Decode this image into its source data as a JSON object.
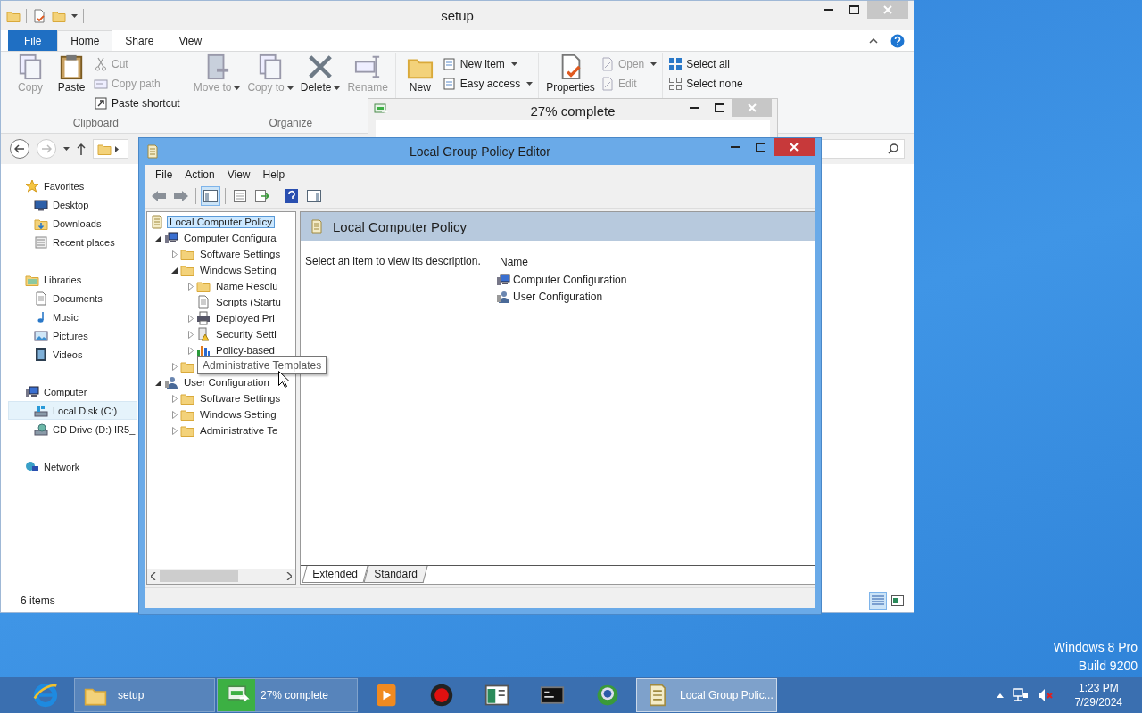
{
  "explorer": {
    "title": "setup",
    "ribbon_tabs": [
      {
        "label": "File",
        "kind": "file",
        "selected": false
      },
      {
        "label": "Home",
        "kind": "tab",
        "selected": true
      },
      {
        "label": "Share",
        "kind": "tab",
        "selected": false
      },
      {
        "label": "View",
        "kind": "tab",
        "selected": false
      }
    ],
    "ribbon_groups": [
      {
        "label": "Clipboard",
        "large": [
          {
            "label": "Copy",
            "kind": "copy",
            "disabled": true,
            "dropdown": false
          },
          {
            "label": "Paste",
            "kind": "paste",
            "disabled": false,
            "dropdown": false
          }
        ],
        "small": [
          {
            "label": "Cut",
            "kind": "cut",
            "disabled": true,
            "dropdown": false
          },
          {
            "label": "Copy path",
            "kind": "path",
            "disabled": true,
            "dropdown": false
          },
          {
            "label": "Paste shortcut",
            "kind": "shortcut",
            "disabled": false,
            "dropdown": false
          }
        ]
      },
      {
        "label": "Organize",
        "large": [
          {
            "label": "Move to",
            "kind": "move",
            "disabled": true,
            "dropdown": true
          },
          {
            "label": "Copy to",
            "kind": "copyto",
            "disabled": true,
            "dropdown": true
          },
          {
            "label": "Delete",
            "kind": "delete",
            "disabled": false,
            "dropdown": true
          },
          {
            "label": "Rename",
            "kind": "rename",
            "disabled": true,
            "dropdown": false
          }
        ]
      },
      {
        "large": [
          {
            "label": "New",
            "kind": "folder",
            "disabled": false,
            "dropdown": false
          }
        ],
        "small": [
          {
            "label": "New item",
            "kind": "newitem",
            "disabled": false,
            "dropdown": true
          },
          {
            "label": "Easy access",
            "kind": "easy",
            "disabled": false,
            "dropdown": true
          }
        ]
      },
      {
        "large": [
          {
            "label": "Properties",
            "kind": "properties",
            "disabled": false,
            "dropdown": false
          }
        ],
        "small": [
          {
            "label": "Open",
            "kind": "open",
            "disabled": true,
            "dropdown": true
          },
          {
            "label": "Edit",
            "kind": "edit",
            "disabled": true,
            "dropdown": false
          }
        ]
      },
      {
        "small": [
          {
            "label": "Select all",
            "kind": "selectall",
            "disabled": false,
            "dropdown": false
          },
          {
            "label": "Select none",
            "kind": "selectnone",
            "disabled": false,
            "dropdown": false
          }
        ]
      }
    ],
    "nav": [
      {
        "label": "Favorites",
        "kind": "star",
        "selected": false,
        "items": [
          {
            "label": "Desktop",
            "kind": "desktop",
            "selected": false
          },
          {
            "label": "Downloads",
            "kind": "downloads",
            "selected": false
          },
          {
            "label": "Recent places",
            "kind": "recent",
            "selected": false
          }
        ]
      },
      {
        "label": "Libraries",
        "kind": "libraries",
        "selected": false,
        "items": [
          {
            "label": "Documents",
            "kind": "document",
            "selected": false
          },
          {
            "label": "Music",
            "kind": "music",
            "selected": false
          },
          {
            "label": "Pictures",
            "kind": "pictures",
            "selected": false
          },
          {
            "label": "Videos",
            "kind": "videos",
            "selected": false
          }
        ]
      },
      {
        "label": "Computer",
        "kind": "computer",
        "selected": false,
        "items": [
          {
            "label": "Local Disk (C:)",
            "kind": "disk",
            "selected": true
          },
          {
            "label": "CD Drive (D:) IR5_",
            "kind": "cd",
            "selected": false
          }
        ]
      },
      {
        "label": "Network",
        "kind": "network",
        "selected": false
      }
    ],
    "status": "6 items"
  },
  "progress_dialog": {
    "title": "27% complete"
  },
  "gpe": {
    "title": "Local Group Policy Editor",
    "menu": [
      "File",
      "Action",
      "View",
      "Help"
    ],
    "tree": {
      "label": "Local Computer Policy",
      "kind": "policy",
      "selected": true,
      "children": [
        {
          "label": "Computer Configura",
          "kind": "computer",
          "expanded": true,
          "selected": false,
          "children": [
            {
              "label": "Software Settings",
              "kind": "folder",
              "expanded": false,
              "selected": false
            },
            {
              "label": "Windows Setting",
              "kind": "folder",
              "expanded": true,
              "selected": false,
              "children": [
                {
                  "label": "Name Resolu",
                  "kind": "folder",
                  "expanded": false,
                  "selected": false
                },
                {
                  "label": "Scripts (Startu",
                  "kind": "script",
                  "selected": false
                },
                {
                  "label": "Deployed Pri",
                  "kind": "printer",
                  "expanded": false,
                  "selected": false
                },
                {
                  "label": "Security Setti",
                  "kind": "security",
                  "expanded": false,
                  "selected": false
                },
                {
                  "label": "Policy-based",
                  "kind": "chart",
                  "expanded": false,
                  "selected": false
                }
              ]
            },
            {
              "kind": "folder",
              "expanded": false
            }
          ]
        },
        {
          "label": "User Configuration",
          "kind": "user",
          "expanded": true,
          "selected": false,
          "children": [
            {
              "label": "Software Settings",
              "kind": "folder",
              "expanded": false,
              "selected": false
            },
            {
              "label": "Windows Setting",
              "kind": "folder",
              "expanded": false,
              "selected": false
            },
            {
              "label": "Administrative Te",
              "kind": "folder",
              "expanded": false,
              "selected": false
            }
          ]
        }
      ]
    },
    "tooltip": "Administrative Templates",
    "header": "Local Computer Policy",
    "description": "Select an item to view its description.",
    "column": "Name",
    "items": [
      {
        "label": "Computer Configuration",
        "kind": "computer"
      },
      {
        "label": "User Configuration",
        "kind": "user"
      }
    ],
    "tabs": [
      {
        "label": "Extended",
        "selected": true
      },
      {
        "label": "Standard",
        "selected": false
      }
    ]
  },
  "desktop_text": [
    "Windows 8 Pro",
    "Build 9200"
  ],
  "taskbar": {
    "items": [
      {
        "kind": "pinned",
        "selected": false
      },
      {
        "kind": "window",
        "label": "setup",
        "selected": false
      },
      {
        "kind": "window",
        "label": "27% complete",
        "level": 0.27,
        "selected": false
      },
      {
        "kind": "pinned",
        "selected": false
      },
      {
        "kind": "pinned",
        "selected": false
      },
      {
        "kind": "pinned",
        "selected": false
      },
      {
        "kind": "pinned",
        "selected": false
      },
      {
        "kind": "pinned",
        "selected": false
      },
      {
        "kind": "window",
        "label": "Local Group Polic...",
        "selected": true
      }
    ],
    "time": "1:23 PM",
    "date": "7/29/2024"
  }
}
